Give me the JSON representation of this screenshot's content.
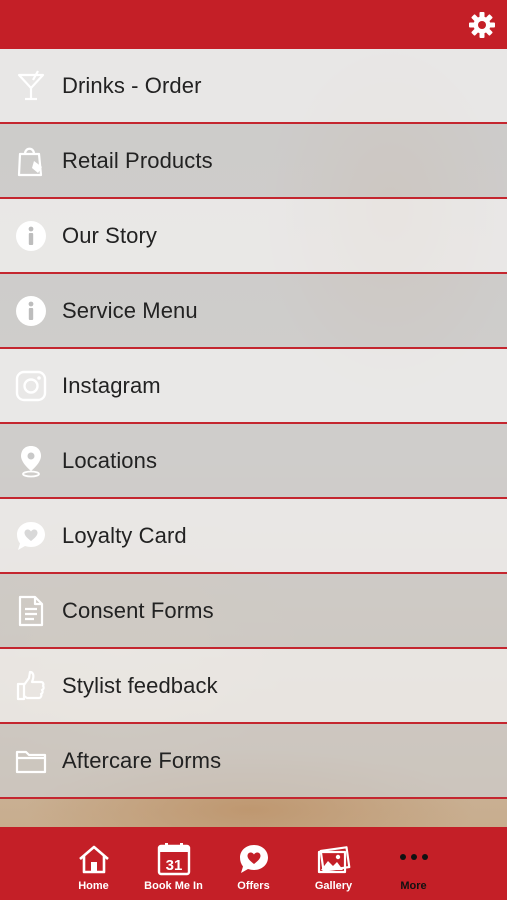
{
  "topbar": {
    "settings_icon": "gear-icon"
  },
  "menu": {
    "items": [
      {
        "label": "Drinks - Order",
        "icon": "cocktail-icon"
      },
      {
        "label": "Retail Products",
        "icon": "shopping-bag-icon"
      },
      {
        "label": "Our Story",
        "icon": "info-icon"
      },
      {
        "label": "Service Menu",
        "icon": "info-icon"
      },
      {
        "label": "Instagram",
        "icon": "instagram-icon"
      },
      {
        "label": "Locations",
        "icon": "location-pin-icon"
      },
      {
        "label": "Loyalty Card",
        "icon": "heart-bubble-icon"
      },
      {
        "label": "Consent Forms",
        "icon": "document-icon"
      },
      {
        "label": "Stylist feedback",
        "icon": "thumbs-up-icon"
      },
      {
        "label": "Aftercare Forms",
        "icon": "folder-icon"
      }
    ]
  },
  "tabbar": {
    "tabs": [
      {
        "label": "Home",
        "icon": "home-icon"
      },
      {
        "label": "Book Me In",
        "icon": "calendar-icon",
        "calendar_day": "31"
      },
      {
        "label": "Offers",
        "icon": "heart-bubble-icon"
      },
      {
        "label": "Gallery",
        "icon": "gallery-icon"
      },
      {
        "label": "More",
        "icon": "more-dots-icon"
      }
    ]
  },
  "colors": {
    "brand_red": "#c41f27",
    "row_divider": "#c4262f",
    "selected_tab_label": "#111111"
  }
}
